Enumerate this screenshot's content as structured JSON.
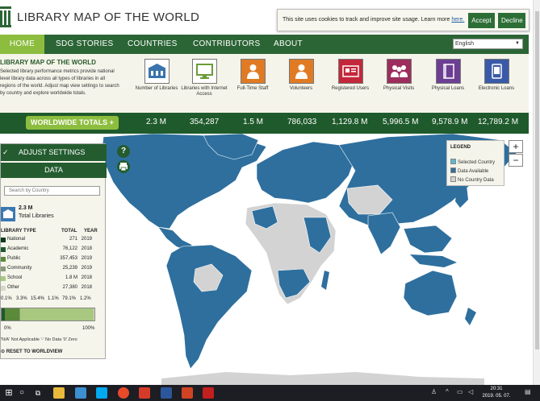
{
  "header": {
    "title": "LIBRARY MAP OF THE WORLD",
    "cookie": {
      "text": "This site uses cookies to track and improve site usage. Learn more ",
      "link": "here.",
      "accept": "Accept",
      "decline": "Decline"
    }
  },
  "nav": {
    "items": [
      "HOME",
      "SDG STORIES",
      "COUNTRIES",
      "CONTRIBUTORS",
      "ABOUT"
    ],
    "language": "English"
  },
  "intro": {
    "title": "LIBRARY MAP OF THE WORLD",
    "text": "Selected library performance metrics provide national level library data across all types of libraries in all regions of the world. Adjust map view settings to search by country and explore worldwide totals."
  },
  "stats": [
    {
      "label": "Number of Libraries",
      "icon": "library-building-icon",
      "color": "#3a73ad",
      "total": "2.3 M"
    },
    {
      "label": "Libraries with Internet Access",
      "icon": "computer-icon",
      "color": "#6a9b38",
      "total": "354,287"
    },
    {
      "label": "Full-Time Staff",
      "icon": "staff-person-icon",
      "color": "#e07b24",
      "total": "1.5 M"
    },
    {
      "label": "Volunteers",
      "icon": "volunteer-icon",
      "color": "#e07b24",
      "total": "786,033"
    },
    {
      "label": "Registered Users",
      "icon": "id-card-icon",
      "color": "#c3273b",
      "total": "1,129.8 M"
    },
    {
      "label": "Physical Visits",
      "icon": "visitors-icon",
      "color": "#9c2d5c",
      "total": "5,996.5 M"
    },
    {
      "label": "Physical Loans",
      "icon": "book-icon",
      "color": "#6c3f93",
      "total": "9,578.9 M"
    },
    {
      "label": "Electronic Loans",
      "icon": "ebook-icon",
      "color": "#3a5aa8",
      "total": "12,789.2 M"
    }
  ],
  "totals": {
    "button": "WORLDWIDE TOTALS +"
  },
  "panel": {
    "adjust": "ADJUST SETTINGS",
    "data_tab": "DATA",
    "search_placeholder": "Search by Country",
    "total_value": "2.3 M",
    "total_label": "Total Libraries",
    "headers": {
      "type": "LIBRARY TYPE",
      "total": "TOTAL",
      "year": "YEAR"
    },
    "rows": [
      {
        "name": "National",
        "total": "271",
        "year": "2019",
        "color": "#0d3a1a"
      },
      {
        "name": "Academic",
        "total": "76,122",
        "year": "2018",
        "color": "#1f5a2c"
      },
      {
        "name": "Public",
        "total": "357,453",
        "year": "2019",
        "color": "#5a8a3a"
      },
      {
        "name": "Community",
        "total": "25,239",
        "year": "2019",
        "color": "#8a9a78"
      },
      {
        "name": "School",
        "total": "1.8 M",
        "year": "2018",
        "color": "#a8c880"
      },
      {
        "name": "Other",
        "total": "27,380",
        "year": "2018",
        "color": "#d8d8c8"
      }
    ],
    "percents": [
      "0.1%",
      "3.3%",
      "15.4%",
      "1.1%",
      "79.1%",
      "1.2%"
    ],
    "bar_values": [
      0.1,
      3.3,
      15.4,
      1.1,
      79.1,
      1.2
    ],
    "bar_min": "0%",
    "bar_max": "100%",
    "note": "'N/A' Not Applicable '-' No Data '0' Zero",
    "reset": "RESET TO WORLDVIEW"
  },
  "legend": {
    "title": "LEGEND",
    "items": [
      {
        "label": "Selected Country",
        "color": "#5bb8cf"
      },
      {
        "label": "Data Available",
        "color": "#2e6f9e"
      },
      {
        "label": "No Country Data",
        "color": "#d3d3d3"
      }
    ]
  },
  "zoom": {
    "in": "+",
    "out": "−"
  },
  "taskbar": {
    "time": "20:31",
    "date": "2019. 05. 07.",
    "lang": "A"
  }
}
